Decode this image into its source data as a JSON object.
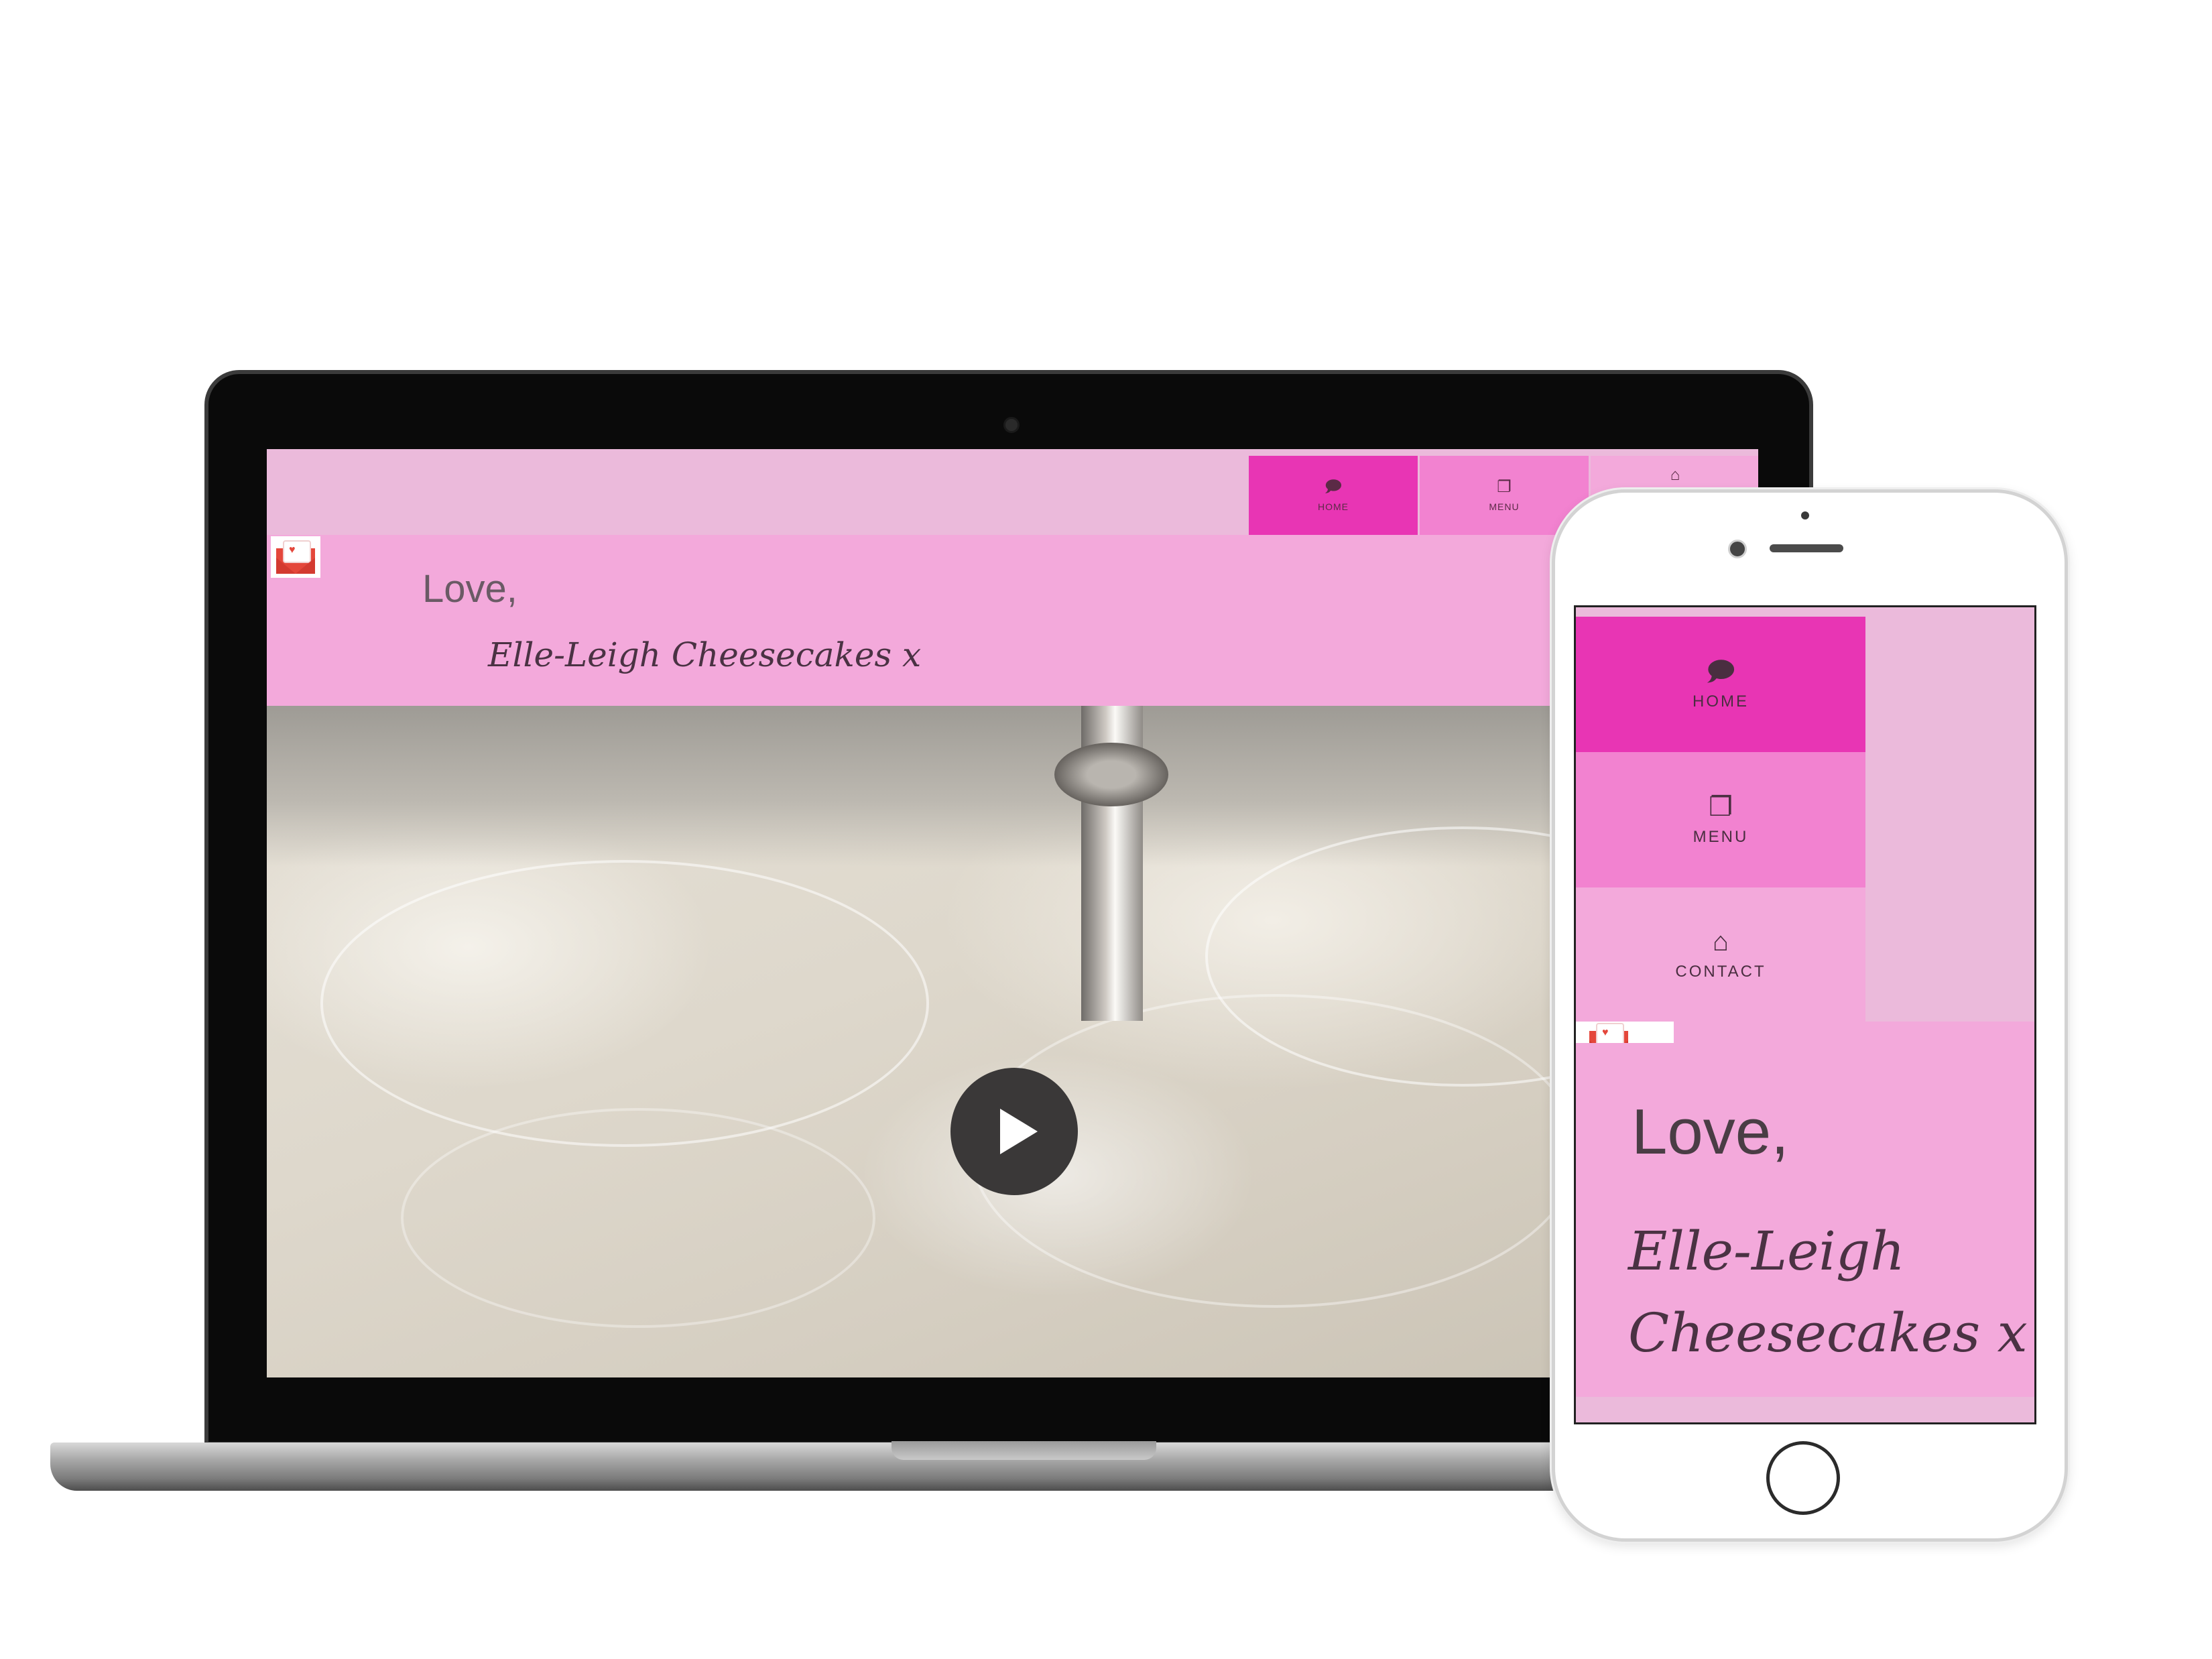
{
  "desktop": {
    "nav": [
      {
        "label": "HOME",
        "icon": "speech-bubble-icon",
        "glyph": "🗩",
        "color": "#e835b4"
      },
      {
        "label": "MENU",
        "icon": "document-copy-icon",
        "glyph": "❐",
        "color": "#f282d0"
      },
      {
        "label": "",
        "icon": "house-icon",
        "glyph": "⌂",
        "color": "#f3a9db"
      }
    ],
    "hero": {
      "greeting": "Love,",
      "signature": "Elle-Leigh Cheesecakes x"
    },
    "video": {
      "play_icon": "play-icon"
    }
  },
  "phone": {
    "nav": [
      {
        "label": "HOME",
        "icon": "speech-bubble-icon",
        "glyph": "🗩",
        "color": "#e835b4"
      },
      {
        "label": "MENU",
        "icon": "document-copy-icon",
        "glyph": "❐",
        "color": "#f282d0"
      },
      {
        "label": "CONTACT",
        "icon": "house-icon",
        "glyph": "⌂",
        "color": "#f3a9db"
      }
    ],
    "hero": {
      "greeting": "Love,",
      "signature": "Elle-Leigh Cheesecakes x"
    }
  },
  "colors": {
    "nav_bar": "#ebbadb",
    "hero_bg": "#f3a9db",
    "hot_pink": "#e835b4",
    "mid_pink": "#f282d0"
  }
}
